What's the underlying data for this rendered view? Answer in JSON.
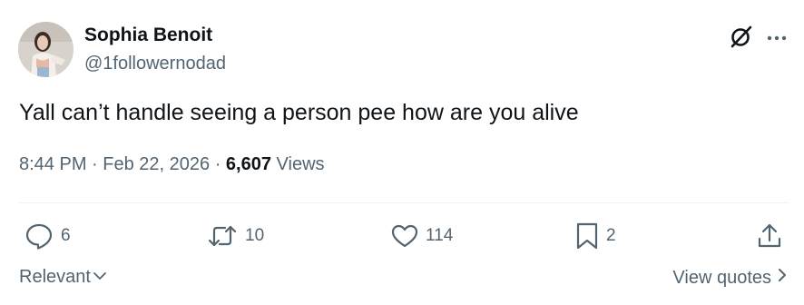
{
  "author": {
    "display_name": "Sophia Benoit",
    "handle": "@1followernodad"
  },
  "tweet": {
    "text": "Yall can’t handle seeing a person pee how are you alive",
    "time": "8:44 PM",
    "date": "Feb 22, 2026",
    "views_count": "6,607",
    "views_label": "Views",
    "separator": "·"
  },
  "actions": {
    "replies": "6",
    "reposts": "10",
    "likes": "114",
    "bookmarks": "2"
  },
  "footer": {
    "sort_label": "Relevant",
    "view_quotes_label": "View quotes"
  },
  "icons": {
    "header": [
      "grok-icon",
      "more-icon"
    ],
    "actions": [
      "reply-icon",
      "repost-icon",
      "like-icon",
      "bookmark-icon",
      "share-icon"
    ]
  },
  "colors": {
    "text_primary": "#0f1419",
    "text_secondary": "#536471",
    "divider": "#eff3f4"
  }
}
